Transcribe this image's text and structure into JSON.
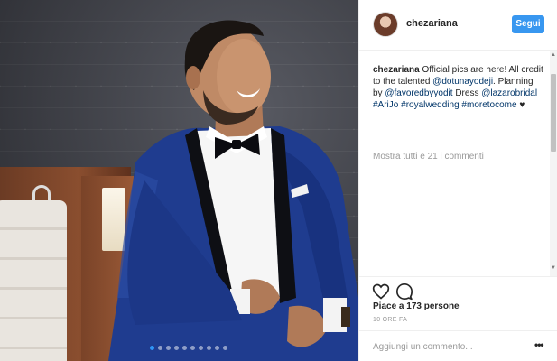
{
  "post": {
    "author": "chezariana",
    "follow_label": "Segui",
    "caption_user": "chezariana",
    "caption_text_1": " Official pics are here! All credit to the talented ",
    "mention_1": "@dotunayodeji",
    "caption_text_2": ". Planning by ",
    "mention_2": "@favoredbyyodit",
    "caption_text_3": " Dress ",
    "mention_3": "@lazarobridal",
    "caption_text_4": " ",
    "hashtag_1": "#AriJo",
    "caption_text_5": " ",
    "hashtag_2": "#royalwedding",
    "caption_text_6": " ",
    "hashtag_3": "#moretocome",
    "caption_emoji": " ♥",
    "show_comments": "Mostra tutti e 21 i commenti",
    "likes": "Piace a 173 persone",
    "time": "10 ORE FA",
    "comment_placeholder": "Aggiungi un commento...",
    "options": "•••"
  },
  "carousel": {
    "count": 10,
    "active_index": 0
  },
  "icons": {
    "like": "heart-icon",
    "comment": "comment-icon",
    "options": "more-options-icon"
  },
  "colors": {
    "accent": "#3897f0",
    "link": "#003569",
    "muted": "#999999"
  }
}
